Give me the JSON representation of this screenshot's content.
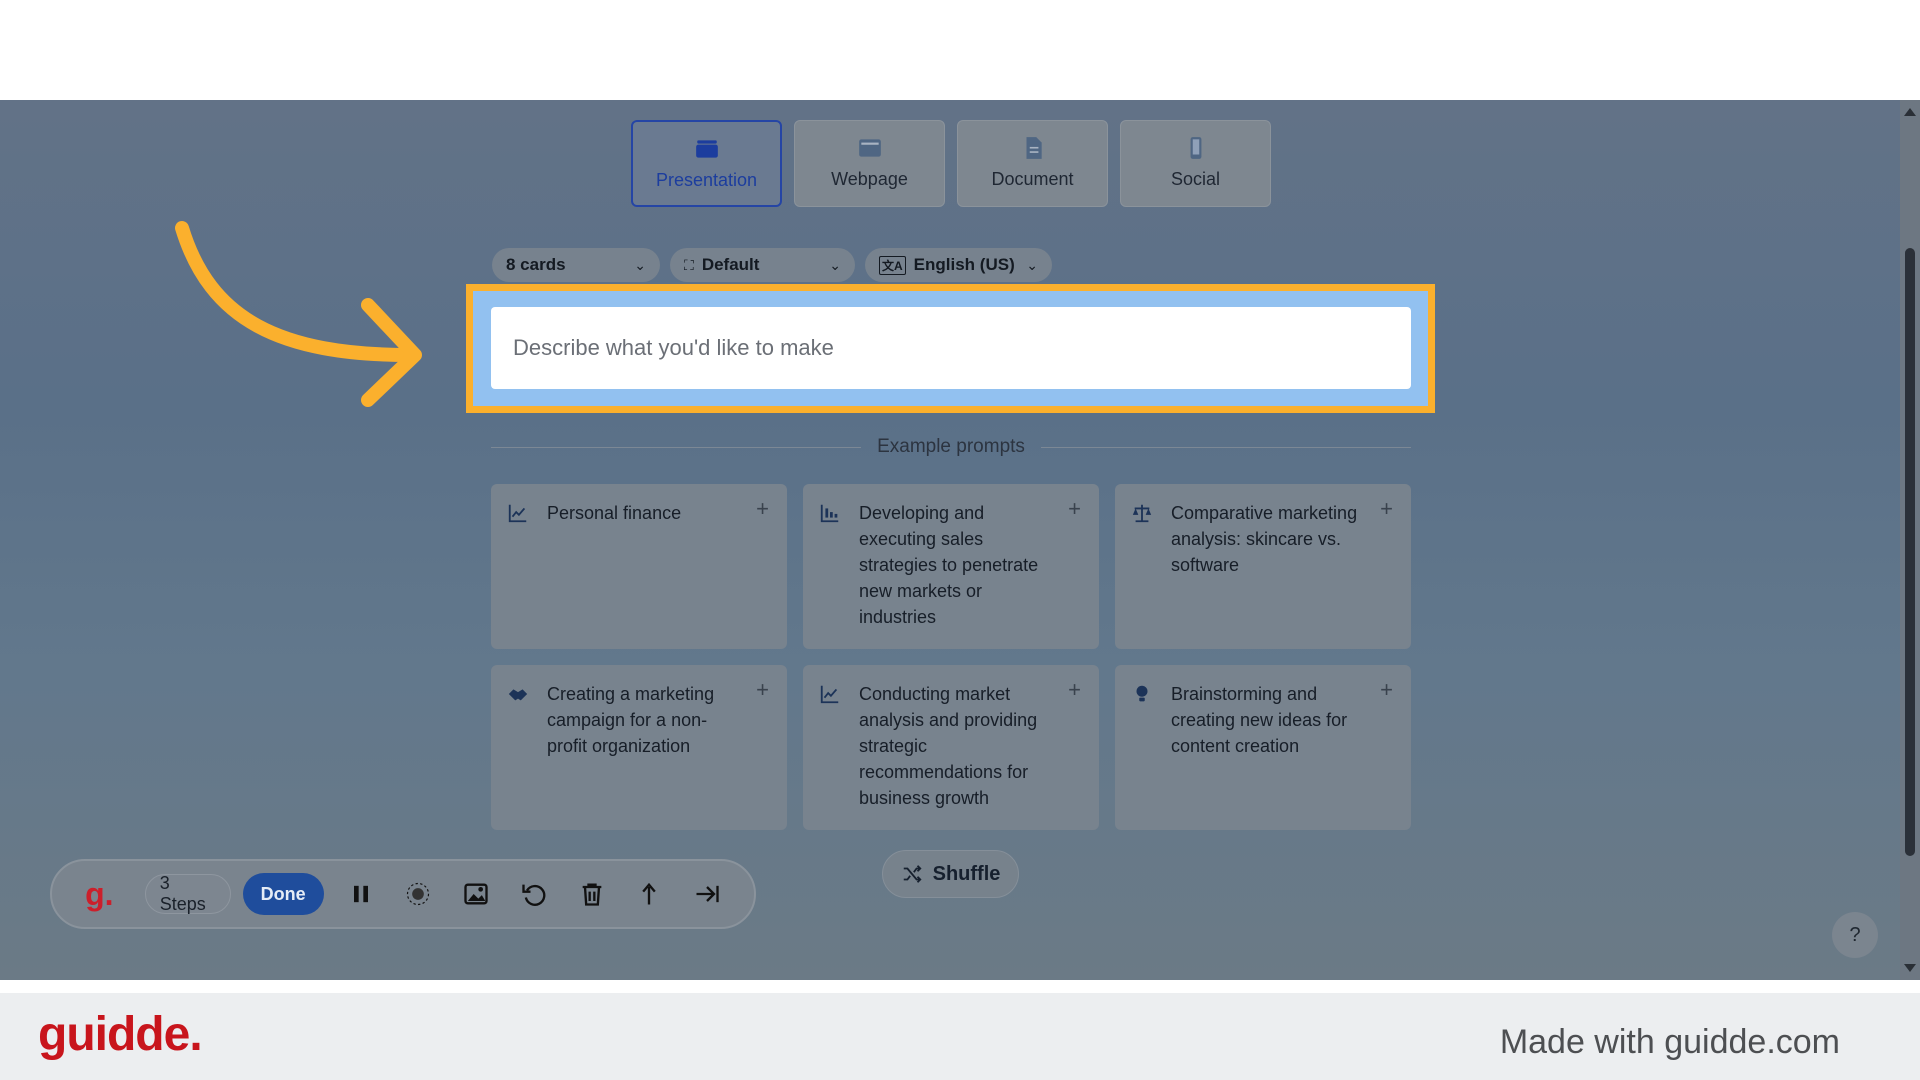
{
  "tabs": [
    {
      "label": "Presentation",
      "icon": "presentation-icon",
      "active": true
    },
    {
      "label": "Webpage",
      "icon": "webpage-icon",
      "active": false
    },
    {
      "label": "Document",
      "icon": "document-icon",
      "active": false
    },
    {
      "label": "Social",
      "icon": "phone-icon",
      "active": false
    }
  ],
  "selectors": {
    "cards": "8 cards",
    "theme": "Default",
    "language": "English (US)"
  },
  "prompt": {
    "placeholder": "Describe what you'd like to make",
    "value": ""
  },
  "examples": {
    "header": "Example prompts",
    "items": [
      {
        "text": "Personal finance",
        "icon": "line-chart-icon"
      },
      {
        "text": "Developing and executing sales strategies to penetrate new markets or industries",
        "icon": "bar-chart-icon"
      },
      {
        "text": "Comparative marketing analysis: skincare vs. software",
        "icon": "scale-icon"
      },
      {
        "text": "Creating a marketing campaign for a non-profit organization",
        "icon": "handshake-icon"
      },
      {
        "text": "Conducting market analysis and providing strategic recommendations for business growth",
        "icon": "line-chart-icon"
      },
      {
        "text": "Brainstorming and creating new ideas for content creation",
        "icon": "lightbulb-icon"
      }
    ],
    "shuffle": "Shuffle"
  },
  "help": "?",
  "recorder": {
    "logo": "g.",
    "steps": "3 Steps",
    "done": "Done",
    "icons": [
      "pause-icon",
      "blur-icon",
      "image-icon",
      "undo-icon",
      "trash-icon",
      "branch-icon",
      "skip-icon"
    ]
  },
  "footer": {
    "logo": "guidde.",
    "text": "Made with guidde.com"
  },
  "colors": {
    "highlight": "#fbb02d",
    "brand_red": "#c8151c",
    "active_tab": "#1c3d9e"
  }
}
